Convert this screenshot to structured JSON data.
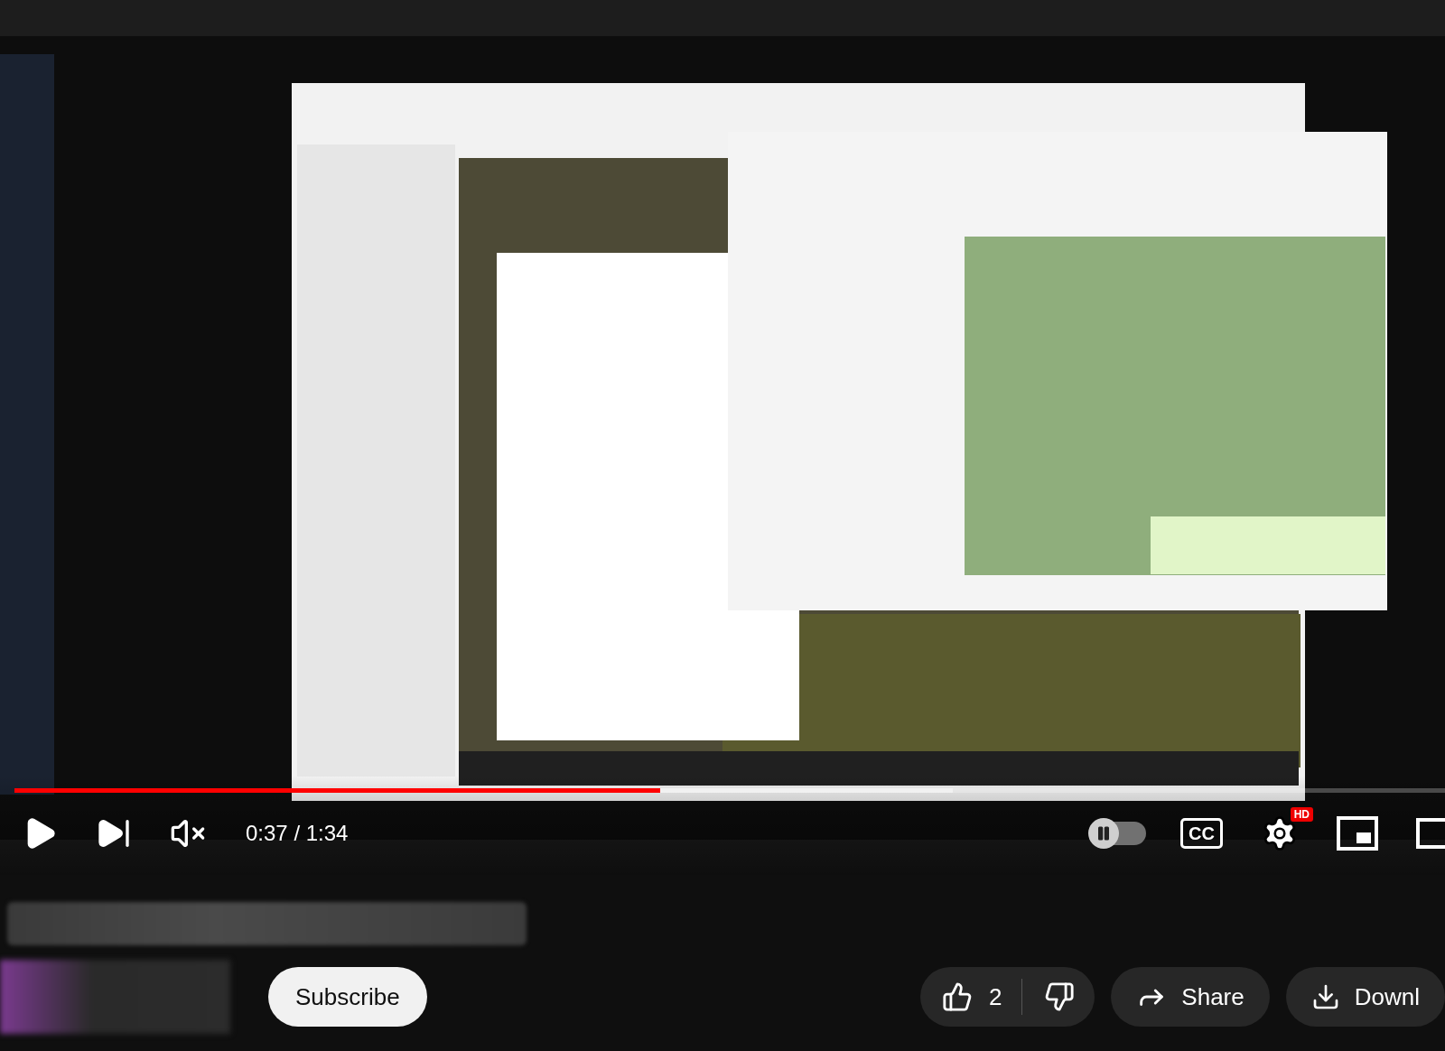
{
  "player": {
    "progress": {
      "level": 0.44
    },
    "buffer": {
      "level": 0.64
    },
    "muted": true,
    "time": "0:37 / 1:34",
    "autoplay": {
      "on": false
    },
    "captions_label": "CC",
    "quality_badge": "HD"
  },
  "below": {
    "subscribe": "Subscribe",
    "likes": "2",
    "share": "Share",
    "download": "Downl"
  }
}
